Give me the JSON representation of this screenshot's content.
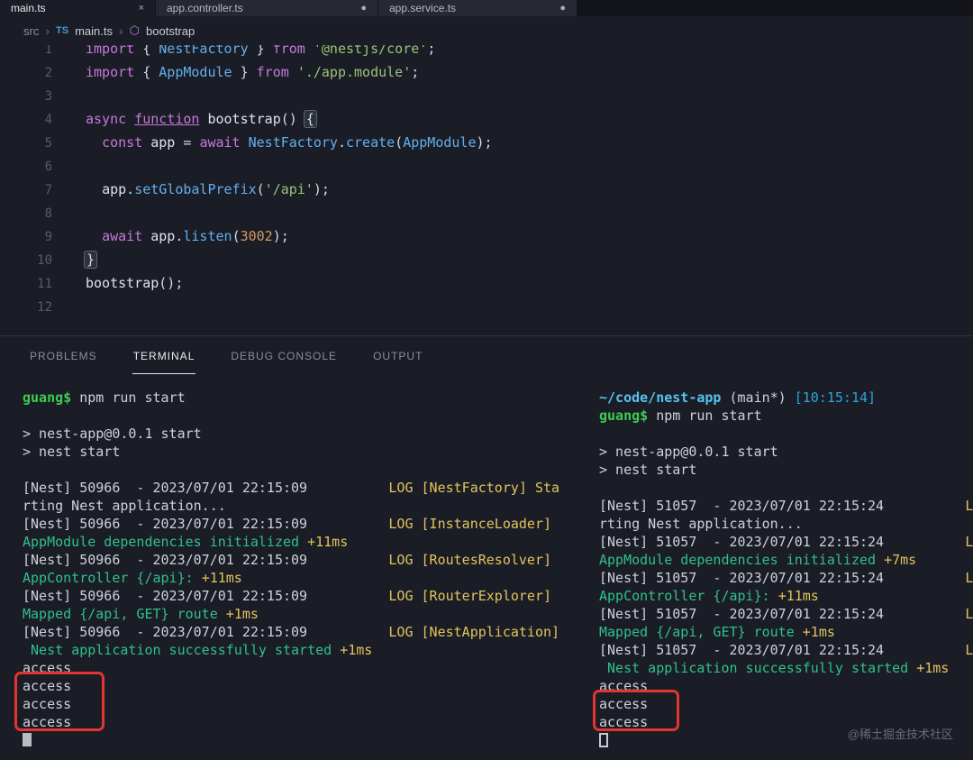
{
  "window": {
    "tabs": [
      {
        "label": "main.ts",
        "mark": "×",
        "active": true
      },
      {
        "label": "app.controller.ts",
        "mark": "●",
        "active": false
      },
      {
        "label": "app.service.ts",
        "mark": "●",
        "active": false
      }
    ]
  },
  "breadcrumb": {
    "separator": "›",
    "ts_icon": "TS",
    "symbol_icon": "⬡",
    "items": [
      {
        "label": "src",
        "icon": null
      },
      {
        "label": "main.ts",
        "icon": "ts"
      },
      {
        "label": "bootstrap",
        "icon": "symbol"
      }
    ]
  },
  "editor": {
    "lines": [
      {
        "num": "1",
        "segs": [
          {
            "t": "import ",
            "c": "kw"
          },
          {
            "t": "{ ",
            "c": "fg"
          },
          {
            "t": "NestFactory",
            "c": "cls"
          },
          {
            "t": " } ",
            "c": "fg"
          },
          {
            "t": "from ",
            "c": "kw"
          },
          {
            "t": "'@nestjs/core'",
            "c": "str"
          },
          {
            "t": ";",
            "c": "fg"
          }
        ]
      },
      {
        "num": "2",
        "segs": [
          {
            "t": "import ",
            "c": "kw"
          },
          {
            "t": "{ ",
            "c": "fg"
          },
          {
            "t": "AppModule",
            "c": "cls"
          },
          {
            "t": " } ",
            "c": "fg"
          },
          {
            "t": "from ",
            "c": "kw"
          },
          {
            "t": "'./app.module'",
            "c": "str"
          },
          {
            "t": ";",
            "c": "fg"
          }
        ]
      },
      {
        "num": "3",
        "segs": []
      },
      {
        "num": "4",
        "segs": [
          {
            "t": "async ",
            "c": "kw"
          },
          {
            "t": "function",
            "c": "kwu"
          },
          {
            "t": " ",
            "c": "fg"
          },
          {
            "t": "bootstrap",
            "c": "fn"
          },
          {
            "t": "() ",
            "c": "fg"
          },
          {
            "t": "{",
            "c": "brc"
          }
        ]
      },
      {
        "num": "5",
        "segs": [
          {
            "t": "  ",
            "c": "fg"
          },
          {
            "t": "const ",
            "c": "kw"
          },
          {
            "t": "app",
            "c": "var"
          },
          {
            "t": " = ",
            "c": "fg"
          },
          {
            "t": "await ",
            "c": "kw"
          },
          {
            "t": "NestFactory",
            "c": "cls"
          },
          {
            "t": ".",
            "c": "fg"
          },
          {
            "t": "create",
            "c": "mth"
          },
          {
            "t": "(",
            "c": "fg"
          },
          {
            "t": "AppModule",
            "c": "cls"
          },
          {
            "t": ");",
            "c": "fg"
          }
        ]
      },
      {
        "num": "6",
        "segs": []
      },
      {
        "num": "7",
        "segs": [
          {
            "t": "  ",
            "c": "fg"
          },
          {
            "t": "app",
            "c": "var"
          },
          {
            "t": ".",
            "c": "fg"
          },
          {
            "t": "setGlobalPrefix",
            "c": "mth"
          },
          {
            "t": "(",
            "c": "fg"
          },
          {
            "t": "'/api'",
            "c": "str"
          },
          {
            "t": ");",
            "c": "fg"
          }
        ]
      },
      {
        "num": "8",
        "segs": []
      },
      {
        "num": "9",
        "segs": [
          {
            "t": "  ",
            "c": "fg"
          },
          {
            "t": "await ",
            "c": "kw"
          },
          {
            "t": "app",
            "c": "var"
          },
          {
            "t": ".",
            "c": "fg"
          },
          {
            "t": "listen",
            "c": "mth"
          },
          {
            "t": "(",
            "c": "fg"
          },
          {
            "t": "3002",
            "c": "num"
          },
          {
            "t": ");",
            "c": "fg"
          }
        ]
      },
      {
        "num": "10",
        "segs": [
          {
            "t": "}",
            "c": "brc"
          }
        ]
      },
      {
        "num": "11",
        "segs": [
          {
            "t": "bootstrap",
            "c": "fn"
          },
          {
            "t": "();",
            "c": "fg"
          }
        ]
      },
      {
        "num": "12",
        "segs": []
      }
    ]
  },
  "panel": {
    "tabs": [
      "PROBLEMS",
      "TERMINAL",
      "DEBUG CONSOLE",
      "OUTPUT"
    ],
    "active_tab": "TERMINAL"
  },
  "terminals": {
    "left": {
      "lines": [
        [
          {
            "t": "guang$",
            "c": "prompt"
          },
          {
            "t": " npm run start",
            "c": "fg"
          }
        ],
        [],
        [
          {
            "t": "> nest-app@0.0.1 start",
            "c": "fg"
          }
        ],
        [
          {
            "t": "> nest start",
            "c": "fg"
          }
        ],
        [],
        [
          {
            "t": "[Nest] 50966  - 2023/07/01 22:15:09          ",
            "c": "fg"
          },
          {
            "t": "LOG [NestFactory] Sta",
            "c": "yel"
          }
        ],
        [
          {
            "t": "rting Nest application...",
            "c": "fg"
          }
        ],
        [
          {
            "t": "[Nest] 50966  - 2023/07/01 22:15:09          ",
            "c": "fg"
          },
          {
            "t": "LOG [InstanceLoader] ",
            "c": "yel"
          }
        ],
        [
          {
            "t": "AppModule dependencies initialized ",
            "c": "msg"
          },
          {
            "t": "+11ms",
            "c": "yel"
          }
        ],
        [
          {
            "t": "[Nest] 50966  - 2023/07/01 22:15:09          ",
            "c": "fg"
          },
          {
            "t": "LOG [RoutesResolver] ",
            "c": "yel"
          }
        ],
        [
          {
            "t": "AppController {/api}: ",
            "c": "msg"
          },
          {
            "t": "+11ms",
            "c": "yel"
          }
        ],
        [
          {
            "t": "[Nest] 50966  - 2023/07/01 22:15:09          ",
            "c": "fg"
          },
          {
            "t": "LOG [RouterExplorer] ",
            "c": "yel"
          }
        ],
        [
          {
            "t": "Mapped {/api, GET} route ",
            "c": "msg"
          },
          {
            "t": "+1ms",
            "c": "yel"
          }
        ],
        [
          {
            "t": "[Nest] 50966  - 2023/07/01 22:15:09          ",
            "c": "fg"
          },
          {
            "t": "LOG [NestApplication]",
            "c": "yel"
          }
        ],
        [
          {
            "t": " Nest application successfully started ",
            "c": "msg"
          },
          {
            "t": "+1ms",
            "c": "yel"
          }
        ],
        [
          {
            "t": "access",
            "c": "fg"
          }
        ],
        [
          {
            "t": "access",
            "c": "fg"
          }
        ],
        [
          {
            "t": "access",
            "c": "fg"
          }
        ],
        [
          {
            "t": "access",
            "c": "fg"
          }
        ],
        [
          {
            "t": "",
            "c": "sol"
          }
        ]
      ]
    },
    "right": {
      "lines": [
        [
          {
            "t": "~/code/nest-app",
            "c": "path"
          },
          {
            "t": " (main*) ",
            "c": "fg"
          },
          {
            "t": "[10:15:14]",
            "c": "time"
          }
        ],
        [
          {
            "t": "guang$",
            "c": "prompt"
          },
          {
            "t": " npm run start",
            "c": "fg"
          }
        ],
        [],
        [
          {
            "t": "> nest-app@0.0.1 start",
            "c": "fg"
          }
        ],
        [
          {
            "t": "> nest start",
            "c": "fg"
          }
        ],
        [],
        [
          {
            "t": "[Nest] 51057  - 2023/07/01 22:15:24          ",
            "c": "fg"
          },
          {
            "t": "LOG [NestFactory] Sta",
            "c": "yel"
          }
        ],
        [
          {
            "t": "rting Nest application...",
            "c": "fg"
          }
        ],
        [
          {
            "t": "[Nest] 51057  - 2023/07/01 22:15:24          ",
            "c": "fg"
          },
          {
            "t": "LOG [InstanceLoader] ",
            "c": "yel"
          }
        ],
        [
          {
            "t": "AppModule dependencies initialized ",
            "c": "msg"
          },
          {
            "t": "+7ms",
            "c": "yel"
          }
        ],
        [
          {
            "t": "[Nest] 51057  - 2023/07/01 22:15:24          ",
            "c": "fg"
          },
          {
            "t": "LOG [RoutesResolver] ",
            "c": "yel"
          }
        ],
        [
          {
            "t": "AppController {/api}: ",
            "c": "msg"
          },
          {
            "t": "+11ms",
            "c": "yel"
          }
        ],
        [
          {
            "t": "[Nest] 51057  - 2023/07/01 22:15:24          ",
            "c": "fg"
          },
          {
            "t": "LOG [RouterExplorer] ",
            "c": "yel"
          }
        ],
        [
          {
            "t": "Mapped {/api, GET} route ",
            "c": "msg"
          },
          {
            "t": "+1ms",
            "c": "yel"
          }
        ],
        [
          {
            "t": "[Nest] 51057  - 2023/07/01 22:15:24          ",
            "c": "fg"
          },
          {
            "t": "LOG [NestApplication]",
            "c": "yel"
          }
        ],
        [
          {
            "t": " Nest application successfully started ",
            "c": "msg"
          },
          {
            "t": "+1ms",
            "c": "yel"
          }
        ],
        [
          {
            "t": "access",
            "c": "fg"
          }
        ],
        [
          {
            "t": "access",
            "c": "fg"
          }
        ],
        [
          {
            "t": "access",
            "c": "fg"
          }
        ],
        [
          {
            "t": "",
            "c": "hol"
          }
        ]
      ]
    }
  },
  "watermark": "@稀土掘金技术社区",
  "colors": {
    "background": "#1b1d26",
    "annotation_red": "#e23430",
    "log_yellow": "#e3c35e",
    "log_green": "#2fc08a",
    "prompt_green": "#3dcb51",
    "path_cyan": "#55c4f2",
    "keyword_purple": "#c678dd",
    "type_blue": "#61afef",
    "string_green": "#98c379",
    "number_orange": "#d19a66"
  }
}
